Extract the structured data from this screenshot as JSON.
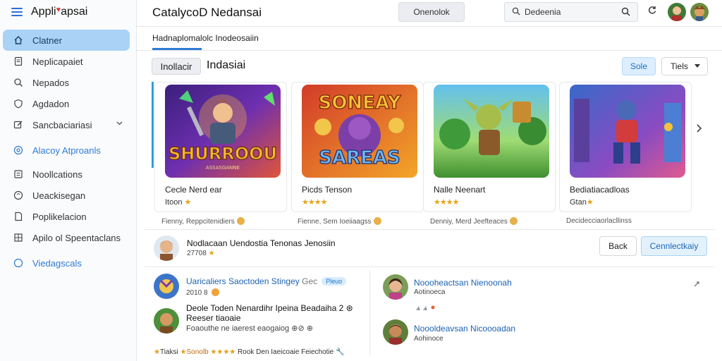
{
  "app": {
    "name": "Appli",
    "name_accent": "♥",
    "name_tail": "apsai"
  },
  "sidebar": {
    "items": [
      {
        "label": "Clatner",
        "icon": "home-icon",
        "active": true
      },
      {
        "label": "Neplicapaiet",
        "icon": "document-icon"
      },
      {
        "label": "Nepados",
        "icon": "search-icon"
      },
      {
        "label": "Agdadon",
        "icon": "shield-icon"
      },
      {
        "label": "Sancbaciariasi",
        "icon": "edit-icon",
        "expandable": true
      },
      {
        "label": "Alacoy Atproanls",
        "icon": "at-icon",
        "link": true
      },
      {
        "label": "Noollcations",
        "icon": "list-icon"
      },
      {
        "label": "Ueackisegan",
        "icon": "help-icon"
      },
      {
        "label": "Poplikelacion",
        "icon": "file-icon"
      },
      {
        "label": "Apilo ol Speentaclans",
        "icon": "grid-icon"
      },
      {
        "label": "Viedagscals",
        "icon": "circle-icon",
        "link": true
      }
    ]
  },
  "header": {
    "title": "CatalycoD Nedansai",
    "button": "Onenolok",
    "search_value": "Dedeenia"
  },
  "tabs": [
    {
      "label": "Hadnaplomalolc Inodeosaiin",
      "active": true
    }
  ],
  "section": {
    "chip": "Inollacir",
    "title": "Indasiai",
    "primary_button": "Sole",
    "sort_label": "Tiels"
  },
  "cards": [
    {
      "name": "Cecle Nerd ear",
      "rating": "Itoon",
      "rating_stars": "★",
      "meta": "Fienny, Reppcitenidiers",
      "art": {
        "title": "SHURROOU",
        "subtitle": "ASSASGANNE",
        "bg1": "#5a2da8",
        "bg2": "#e0553d",
        "title_color": "#f5b72a"
      }
    },
    {
      "name": "Picds Tenson",
      "rating": "",
      "rating_stars": "★★★★",
      "meta": "Fienne, Sem Ioeiiaagss",
      "art": {
        "title": "SONEAY",
        "subtitle": "SAREAS",
        "bg1": "#d83a2d",
        "bg2": "#f3a529",
        "title_color": "#f8c336"
      }
    },
    {
      "name": "Nalle Neenart",
      "rating": "",
      "rating_stars": "★★★★",
      "meta": "Denniy, Merd Jeefteaces",
      "art": {
        "title": "",
        "subtitle": "",
        "bg1": "#58b5e8",
        "bg2": "#4e9d3a",
        "title_color": "#ffffff"
      }
    },
    {
      "name": "Bediatiacadloas",
      "rating": "Gtan",
      "rating_stars": "★",
      "meta": "Decidecciaorlacllinss",
      "art": {
        "title": "",
        "subtitle": "",
        "bg1": "#3a6fd1",
        "bg2": "#e05a8f",
        "title_color": "#ffffff"
      }
    }
  ],
  "featured": {
    "title": "Nodlacaan Uendostia Tenonas Jenosiin",
    "subtitle": "27708",
    "subtitle_stars": "★",
    "back_button": "Back",
    "connect_button": "Cennlectkaiy"
  },
  "comments_left": [
    {
      "title": "Uaricaliers Saoctoden Stingey",
      "title_tail": "Gec",
      "badge": "Pleuo",
      "sub": "2010 8"
    },
    {
      "title": "Deole Toden Nenardihr Ipeina Beadaiha 2 ⊛",
      "title2": "Reeser tiaoaie",
      "sub": "Foaouthe ne iaerest eaogaiog ⊕⊘ ⊕"
    }
  ],
  "comments_right": [
    {
      "title": "Noooheactsan Nienoonah",
      "sub": "Aotinoeca"
    },
    {
      "title": "Noooldeavsan Nicoooadan",
      "sub": "Aohinoce"
    }
  ],
  "footer": {
    "prefix": "Tiaksi",
    "highlight": "Sonolb",
    "suffix": "Rook Den Iaeicoaie Feiechotie 🔧"
  },
  "colors": {
    "accent": "#2f7ad6",
    "active_nav": "#a9d2f6",
    "star": "#e6a417"
  }
}
